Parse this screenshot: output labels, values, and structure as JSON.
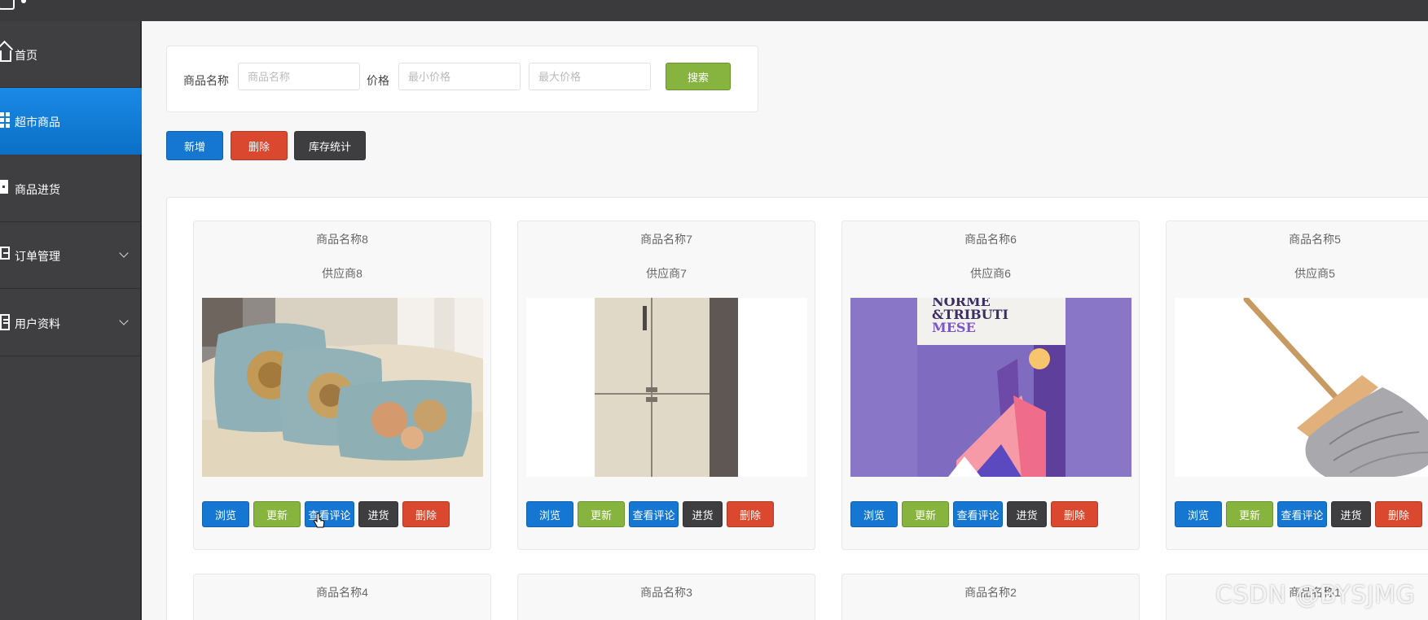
{
  "sidebar": {
    "items": [
      {
        "label": "首页",
        "icon": "home-icon",
        "active": false
      },
      {
        "label": "超市商品",
        "icon": "grid-icon",
        "active": true
      },
      {
        "label": "商品进货",
        "icon": "inbox-icon",
        "active": false
      },
      {
        "label": "订单管理",
        "icon": "order-icon",
        "active": false,
        "expandable": true
      },
      {
        "label": "用户资料",
        "icon": "user-icon",
        "active": false,
        "expandable": true
      }
    ]
  },
  "search": {
    "name_label": "商品名称",
    "name_placeholder": "商品名称",
    "price_label": "价格",
    "min_placeholder": "最小价格",
    "max_placeholder": "最大价格",
    "search_label": "搜索"
  },
  "toolbar": {
    "add_label": "新增",
    "delete_label": "删除",
    "stats_label": "库存统计"
  },
  "card_actions": {
    "view": "浏览",
    "update": "更新",
    "review": "查看评论",
    "stock": "进货",
    "delete": "删除"
  },
  "products": [
    {
      "name": "商品名称8",
      "supplier": "供应商8",
      "image": "cushions"
    },
    {
      "name": "商品名称7",
      "supplier": "供应商7",
      "image": "refrigerator"
    },
    {
      "name": "商品名称6",
      "supplier": "供应商6",
      "image": "book"
    },
    {
      "name": "商品名称5",
      "supplier": "供应商5",
      "image": "mop"
    },
    {
      "name": "商品名称4"
    },
    {
      "name": "商品名称3"
    },
    {
      "name": "商品名称2"
    },
    {
      "name": "商品名称1"
    }
  ],
  "book_cover": {
    "line1": "NORME",
    "line2": "&TRIBUTI",
    "line3": "MESE"
  },
  "watermark": "CSDN @BYSJMG",
  "colors": {
    "primary": "#1677d2",
    "success": "#87b33f",
    "danger": "#d9482f",
    "dark": "#3e3e40",
    "sidebar": "#3f3f41"
  }
}
